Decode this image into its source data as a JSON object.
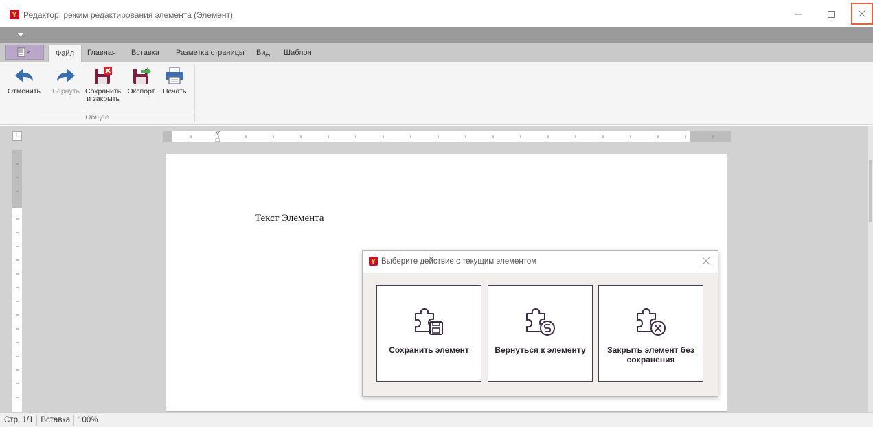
{
  "window": {
    "title": "Редактор: режим редактирования элемента (Элемент)"
  },
  "tabs": [
    {
      "label": "Файл",
      "active": true
    },
    {
      "label": "Главная"
    },
    {
      "label": "Вставка"
    },
    {
      "label": "Разметка страницы"
    },
    {
      "label": "Вид"
    },
    {
      "label": "Шаблон"
    }
  ],
  "ribbon": {
    "undo_label": "Отменить",
    "redo_label": "Вернуть",
    "save_close_label_1": "Сохранить",
    "save_close_label_2": "и закрыть",
    "export_label": "Экспорт",
    "print_label": "Печать",
    "group_label": "Общее"
  },
  "ruler": {
    "corner_label": "L"
  },
  "document": {
    "text": "Текст Элемента"
  },
  "dialog": {
    "title": "Выберите действие с текущим элементом",
    "buttons": [
      {
        "label": "Сохранить элемент",
        "icon": "puzzle-save-icon"
      },
      {
        "label": "Вернуться к элементу",
        "icon": "puzzle-return-icon"
      },
      {
        "label": "Закрыть элемент без сохранения",
        "icon": "puzzle-close-icon"
      }
    ]
  },
  "statusbar": {
    "page": "Стр. 1/1",
    "mode": "Вставка",
    "zoom": "100%"
  },
  "colors": {
    "accent": "#c8102e",
    "dialog_border": "#4a3b52",
    "ribbon_icon_blue": "#3a6fb0",
    "close_highlight": "#e0613a"
  }
}
